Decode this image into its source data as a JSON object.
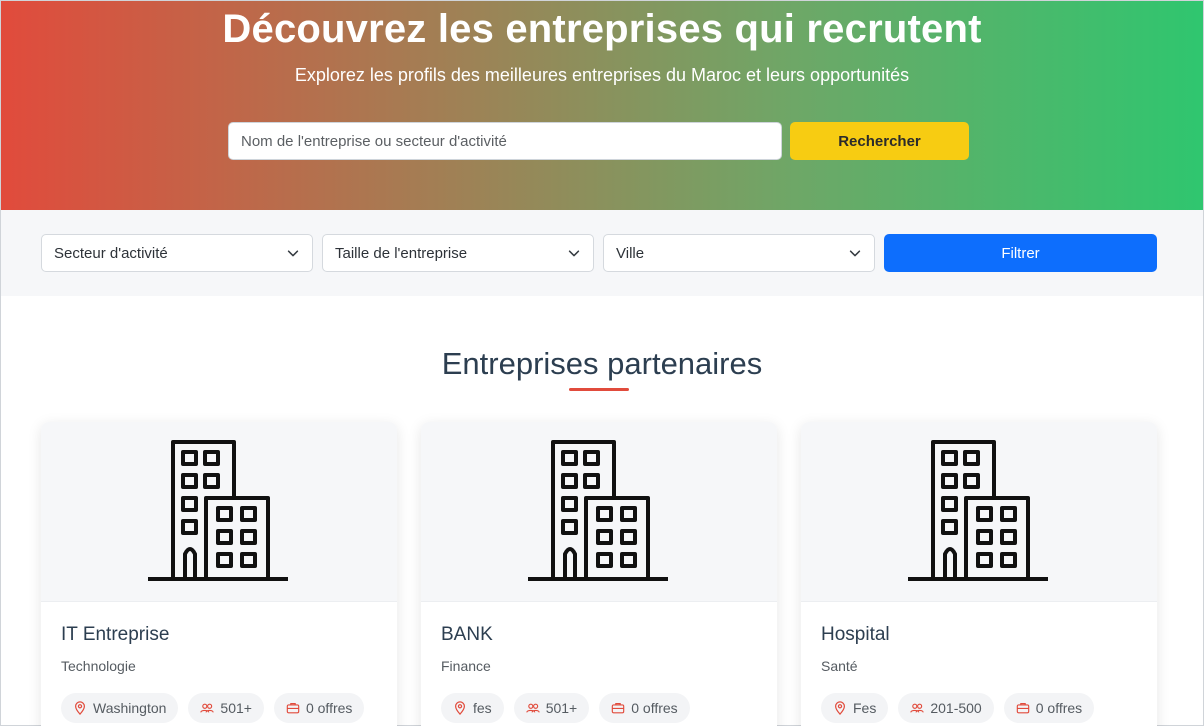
{
  "hero": {
    "title": "Découvrez les entreprises qui recrutent",
    "subtitle": "Explorez les profils des meilleures entreprises du Maroc et leurs opportunités",
    "search_placeholder": "Nom de l'entreprise ou secteur d'activité",
    "search_button": "Rechercher"
  },
  "filters": {
    "sector": "Secteur d'activité",
    "size": "Taille de l'entreprise",
    "city": "Ville",
    "button": "Filtrer"
  },
  "section": {
    "title": "Entreprises partenaires"
  },
  "companies": [
    {
      "name": "IT Entreprise",
      "sector": "Technologie",
      "city": "Washington",
      "size": "501+",
      "offers": "0 offres"
    },
    {
      "name": "BANK",
      "sector": "Finance",
      "city": "fes",
      "size": "501+",
      "offers": "0 offres"
    },
    {
      "name": "Hospital",
      "sector": "Santé",
      "city": "Fes",
      "size": "201-500",
      "offers": "0 offres"
    }
  ],
  "colors": {
    "gradient_start": "#e14b3c",
    "gradient_end": "#2fc66f",
    "search_button": "#f7cc12",
    "filter_button": "#0d6efd",
    "accent_underline": "#e14b3c",
    "tag_icon": "#e14b3c"
  },
  "icons": {
    "card_image": "building-icon",
    "city": "map-pin-icon",
    "size": "users-icon",
    "offers": "briefcase-icon",
    "select": "chevron-down-icon"
  }
}
